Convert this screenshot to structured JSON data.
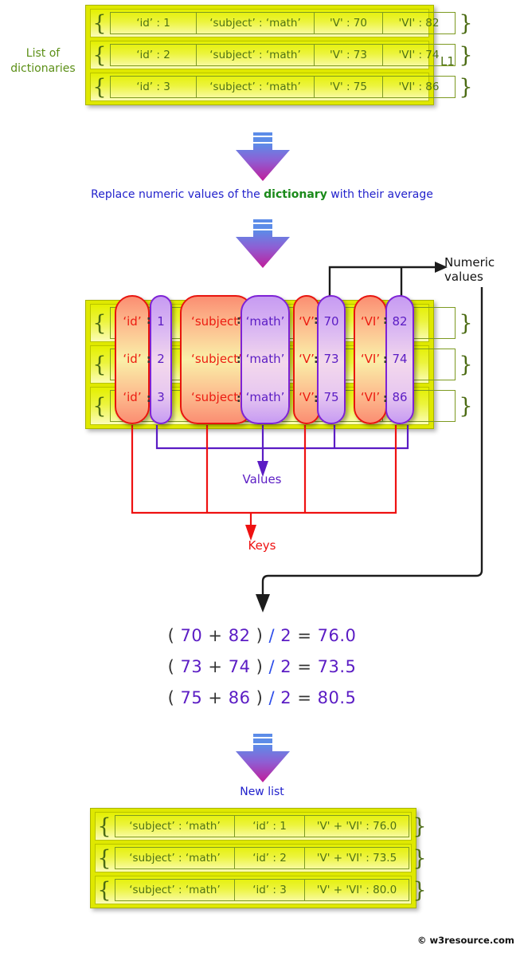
{
  "labels": {
    "list_of_dictionaries": "List of\ndictionaries",
    "l1": "L1",
    "replace_prefix": "Replace numeric values of the ",
    "replace_highlight": "dictionary",
    "replace_suffix": " with their average",
    "numeric_values": "Numeric\nvalues",
    "values": "Values",
    "keys": "Keys",
    "new_list": "New list",
    "watermark": "© w3resource.com"
  },
  "top_table": {
    "brace_open": "{",
    "brace_close": "}",
    "rows": [
      {
        "cells": [
          "‘id’ : 1",
          "‘subject’ : ‘math’",
          "'V' : 70",
          "'VI' : 82"
        ]
      },
      {
        "cells": [
          "‘id’ : 2",
          "‘subject’ : ‘math’",
          "'V' : 73",
          "'VI' : 74"
        ]
      },
      {
        "cells": [
          "‘id’ : 3",
          "‘subject’ : ‘math’",
          "'V' : 75",
          "'VI' : 86"
        ]
      }
    ]
  },
  "mid_diagram": {
    "brace_open": "{",
    "brace_close": "}",
    "colon": ":",
    "columns": [
      {
        "kind": "key",
        "name": "id-key",
        "items": [
          "‘id’",
          "‘id’",
          "‘id’"
        ]
      },
      {
        "kind": "val",
        "name": "id-value",
        "items": [
          "1",
          "2",
          "3"
        ]
      },
      {
        "kind": "key",
        "name": "subject-key",
        "items": [
          "‘subject’",
          "‘subject’",
          "‘subject’"
        ]
      },
      {
        "kind": "val",
        "name": "subject-value",
        "items": [
          "‘math’",
          "‘math’",
          "‘math’"
        ]
      },
      {
        "kind": "key",
        "name": "v-key",
        "items": [
          "‘V’",
          "‘V’",
          "‘V’"
        ]
      },
      {
        "kind": "val",
        "name": "v-value",
        "items": [
          "70",
          "73",
          "75"
        ]
      },
      {
        "kind": "key",
        "name": "vi-key",
        "items": [
          "‘VI’",
          "‘VI’",
          "‘VI’"
        ]
      },
      {
        "kind": "val",
        "name": "vi-value",
        "items": [
          "82",
          "74",
          "86"
        ]
      }
    ]
  },
  "calculations": [
    {
      "open": "(",
      "a": "70",
      "plus": "+",
      "b": "82",
      "close": ")",
      "slash": "/",
      "divisor": "2",
      "eq": "=",
      "result": "76.0"
    },
    {
      "open": "(",
      "a": "73",
      "plus": "+",
      "b": "74",
      "close": ")",
      "slash": "/",
      "divisor": "2",
      "eq": "=",
      "result": "73.5"
    },
    {
      "open": "(",
      "a": "75",
      "plus": "+",
      "b": "86",
      "close": ")",
      "slash": "/",
      "divisor": "2",
      "eq": "=",
      "result": "80.5"
    }
  ],
  "bottom_table": {
    "brace_open": "{",
    "brace_close": "}",
    "rows": [
      {
        "cells": [
          "‘subject’ : ‘math’",
          "‘id’ : 1",
          "'V' + 'VI' : 76.0"
        ]
      },
      {
        "cells": [
          "‘subject’ : ‘math’",
          "‘id’ : 2",
          "'V' + 'VI' : 73.5"
        ]
      },
      {
        "cells": [
          "‘subject’ : ‘math’",
          "‘id’ : 3",
          "'V' + 'VI' : 80.0"
        ]
      }
    ]
  },
  "colors": {
    "table_fill": "#e4f000",
    "table_text": "#4f7215",
    "key_accent": "#ec1c11",
    "value_accent": "#5b1cc4",
    "blue_text": "#2222cc",
    "green_text": "#5b8f16",
    "arrow_top": "#5c8ce8",
    "arrow_bottom": "#c01d9a"
  }
}
